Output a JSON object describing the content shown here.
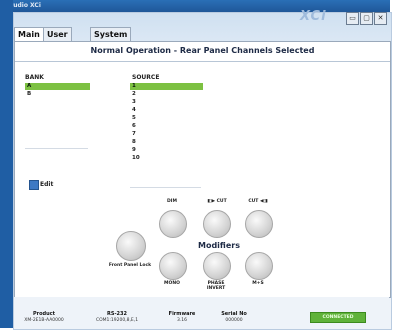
{
  "window": {
    "title": "Studio XCi",
    "logo": "XCi",
    "controls": [
      "▭",
      "▢",
      "✕"
    ]
  },
  "tabs": [
    {
      "label": "Main"
    },
    {
      "label": "User EQ"
    },
    {
      "label": "System"
    }
  ],
  "main": {
    "heading": "Normal Operation - Rear Panel Channels Selected",
    "bank": {
      "label": "BANK",
      "items": [
        "A",
        "B"
      ],
      "selected": "A"
    },
    "source": {
      "label": "SOURCE",
      "items": [
        "1",
        "2",
        "3",
        "4",
        "5",
        "6",
        "7",
        "8",
        "9",
        "10"
      ],
      "selected": "1"
    },
    "edit_label": "Edit"
  },
  "controls": {
    "front_panel_lock": "Front Panel Lock",
    "dim": "DIM",
    "cut_left": "CUT",
    "cut_right": "CUT",
    "mono": "MONO",
    "phase_invert": "PHASE INVERT",
    "m_s": "M+S",
    "modifiers_label": "Modifiers"
  },
  "status": {
    "product": {
      "label": "Product",
      "value": "XM-2E1B-AA0000"
    },
    "rs232": {
      "label": "RS-232",
      "value": "COM1:19200,8,E,1"
    },
    "firmware": {
      "label": "Firmware",
      "value": "3.16"
    },
    "serial": {
      "label": "Serial No",
      "value": "000000"
    },
    "connection": "CONNECTED"
  },
  "colors": {
    "selection": "#7dc142",
    "connected": "#5fb23a",
    "titlebar": "#2a6fb6"
  }
}
